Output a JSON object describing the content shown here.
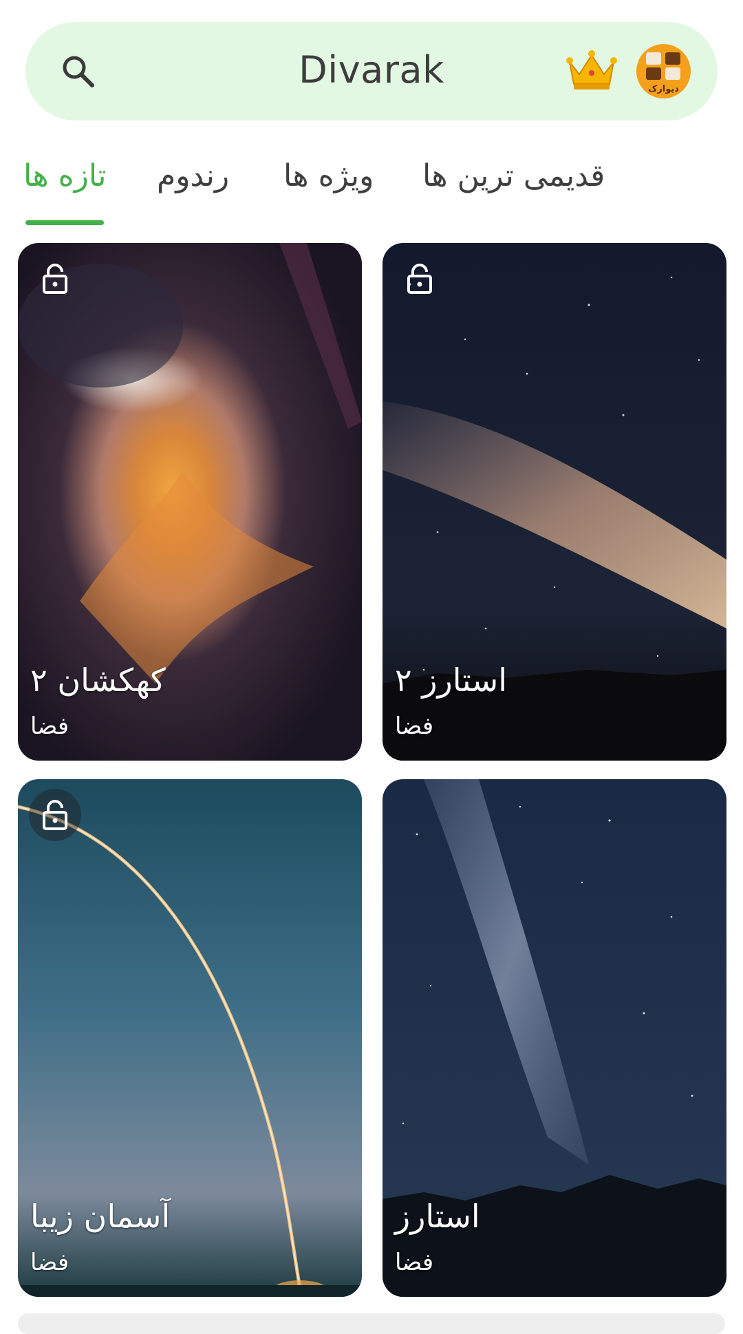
{
  "header": {
    "title": "Divarak",
    "logo_text": "دیوارک"
  },
  "tabs": [
    {
      "label": "تازه ها",
      "active": true
    },
    {
      "label": "رندوم",
      "active": false
    },
    {
      "label": "ویژه ها",
      "active": false
    },
    {
      "label": "قدیمی ترین ها",
      "active": false
    }
  ],
  "cards": [
    {
      "title": "کهکشان ۲",
      "category": "فضا",
      "locked_icon": "unlock-icon"
    },
    {
      "title": "استارز ۲",
      "category": "فضا",
      "locked_icon": "unlock-icon"
    },
    {
      "title": "آسمان زیبا",
      "category": "فضا",
      "locked_icon": "unlock-icon"
    },
    {
      "title": "استارز",
      "category": "فضا"
    }
  ],
  "colors": {
    "accent": "#45b04b",
    "search_bg": "#e3f8e2"
  }
}
